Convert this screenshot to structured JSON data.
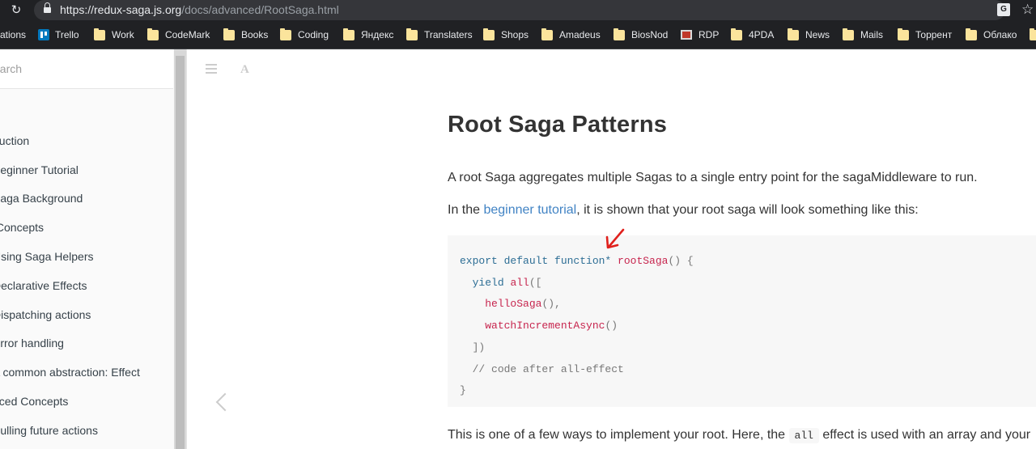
{
  "browser": {
    "url_host": "https://redux-saga.js.org",
    "url_path": "/docs/advanced/RootSaga.html",
    "icons": [
      "reload-icon",
      "lock-icon",
      "translate-icon",
      "star-icon"
    ]
  },
  "bookmarks": [
    {
      "label": "ations",
      "icon": "none"
    },
    {
      "label": "Trello",
      "icon": "trello-icon"
    },
    {
      "label": "Work",
      "icon": "folder-icon"
    },
    {
      "label": "CodeMark",
      "icon": "folder-icon"
    },
    {
      "label": "Books",
      "icon": "folder-icon"
    },
    {
      "label": "Coding",
      "icon": "folder-icon"
    },
    {
      "label": "Яндекс",
      "icon": "folder-icon"
    },
    {
      "label": "Translaters",
      "icon": "folder-icon"
    },
    {
      "label": "Shops",
      "icon": "folder-icon"
    },
    {
      "label": "Amadeus",
      "icon": "folder-icon"
    },
    {
      "label": "BiosNod",
      "icon": "folder-icon"
    },
    {
      "label": "RDP",
      "icon": "rdp-icon"
    },
    {
      "label": "4PDA",
      "icon": "folder-icon"
    },
    {
      "label": "News",
      "icon": "folder-icon"
    },
    {
      "label": "Mails",
      "icon": "folder-icon"
    },
    {
      "label": "Торрент",
      "icon": "folder-icon"
    },
    {
      "label": "Облако",
      "icon": "folder-icon"
    }
  ],
  "sidebar": {
    "search_placeholder": "earch",
    "items": [
      "e",
      "duction",
      "Beginner Tutorial",
      "Saga Background",
      " Concepts",
      "Using Saga Helpers",
      "Declarative Effects",
      "Dispatching actions",
      "Error handling",
      "A common abstraction: Effect",
      "nced Concepts",
      "Pulling future actions"
    ]
  },
  "article": {
    "title": "Root Saga Patterns",
    "intro": "A root Saga aggregates multiple Sagas to a single entry point for the sagaMiddleware to run.",
    "p2_before": "In the ",
    "p2_link": "beginner tutorial",
    "p2_after": ", it is shown that your root saga will look something like this:",
    "p3_before": "This is one of a few ways to implement your root. Here, the ",
    "p3_code": "all",
    "p3_after": " effect is used with an array and your"
  },
  "code": {
    "l1_kw": "export default function*",
    "l1_fn": "rootSaga",
    "l1_rest": "() {",
    "l2_kw": "yield",
    "l2_fn": "all",
    "l2_rest": "([",
    "l3_fn": "helloSaga",
    "l3_rest": "(),",
    "l4_fn": "watchIncrementAsync",
    "l4_rest": "()",
    "l5": "])",
    "l6": "// code after all-effect",
    "l7": "}"
  },
  "colors": {
    "link": "#4183c4",
    "keyword": "#2d6e95",
    "function": "#c7254e",
    "annotation_arrow": "#e0201c"
  }
}
